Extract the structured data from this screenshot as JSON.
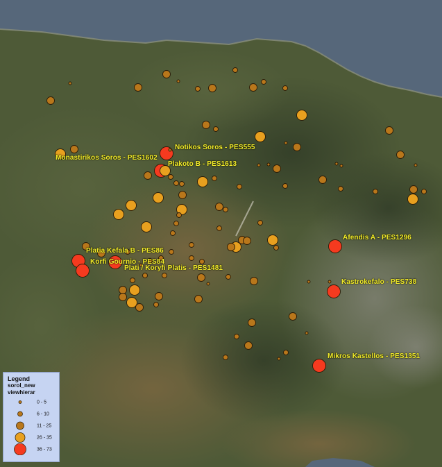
{
  "map": {
    "colors": {
      "sea": "#56677a",
      "land": "#4e5a37",
      "valley": "#6b5e3c",
      "mountain": "#3a4430",
      "site_small": "#b9771b",
      "site_medium": "#e8a01f",
      "site_large": "#f53a1f",
      "label": "#f2ec2a"
    },
    "labels": [
      {
        "text": "Notikos Soros - PES555"
      },
      {
        "text": "Monastirikos Soros - PES1602"
      },
      {
        "text": "Plakoto B - PES1613"
      },
      {
        "text": "Afendis A - PES1296"
      },
      {
        "text": "Platia Kefala B - PES86"
      },
      {
        "text": "Korfi Gournio - PES84"
      },
      {
        "text": "Plati / Koryfi Platis - PES1481"
      },
      {
        "text": "Kastrokefalo - PES738"
      },
      {
        "text": "Mikros Kastellos - PES1351"
      }
    ]
  },
  "legend": {
    "title": "Legend",
    "layer": "sorol_new",
    "field": "viewhierar",
    "classes": [
      {
        "range": "0 - 5",
        "color": "#b9771b",
        "size_class": 1
      },
      {
        "range": "6 - 10",
        "color": "#b9771b",
        "size_class": 2
      },
      {
        "range": "11 - 25",
        "color": "#b9771b",
        "size_class": 3
      },
      {
        "range": "26 - 35",
        "color": "#e8a01f",
        "size_class": 4
      },
      {
        "range": "36 - 73",
        "color": "#f53a1f",
        "size_class": 5
      }
    ]
  }
}
